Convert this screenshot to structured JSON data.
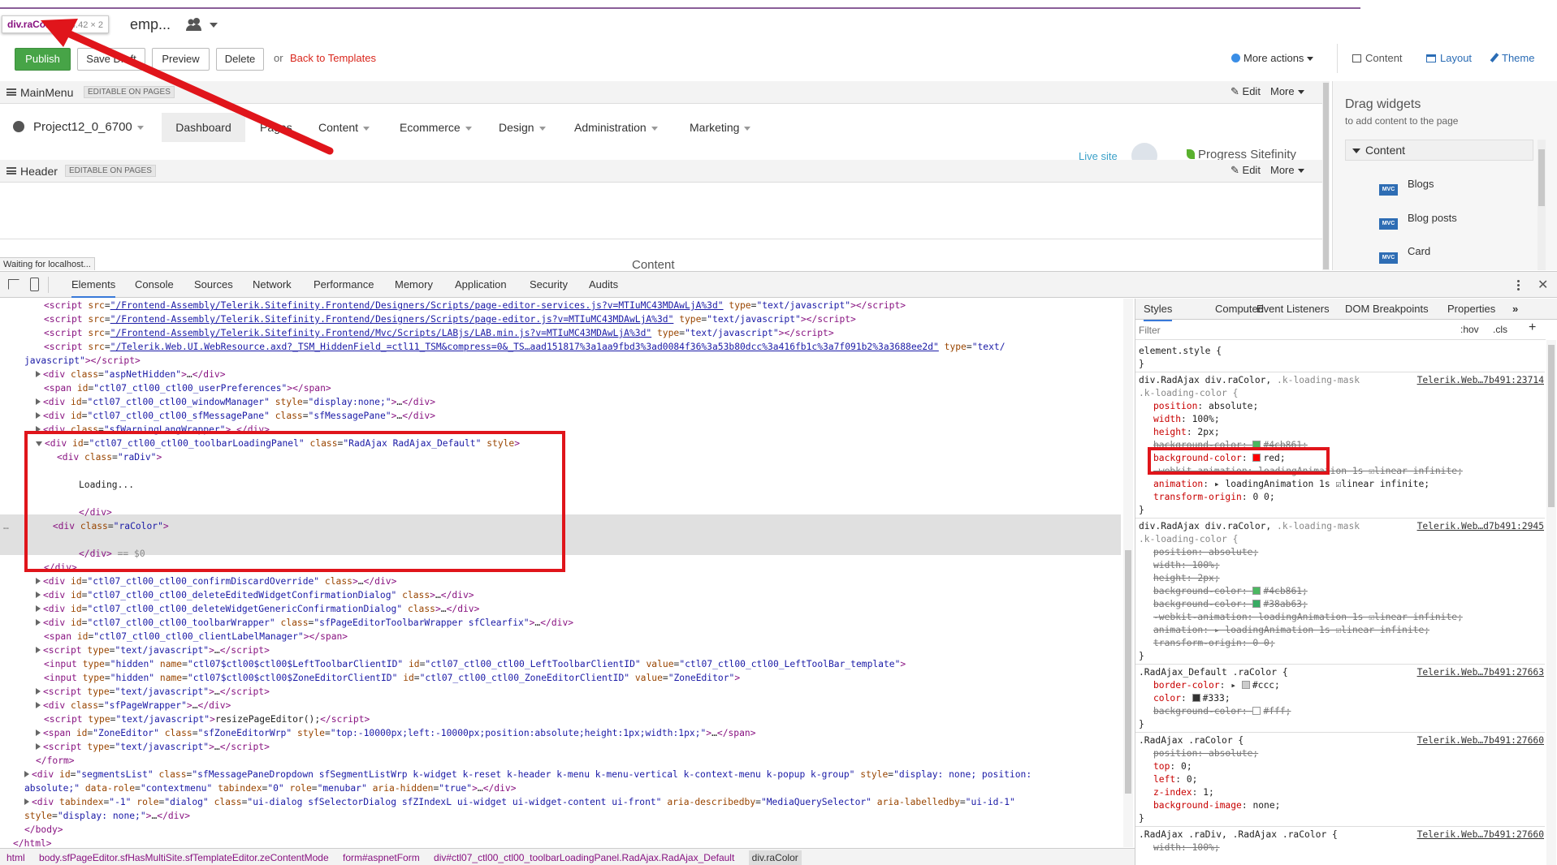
{
  "tooltip": {
    "element": "div.raColor",
    "size": "74.42 × 2"
  },
  "page_title_fragment": "emp...",
  "toolbar": {
    "publish": "Publish",
    "save_draft": "Save Draft",
    "preview": "Preview",
    "delete": "Delete",
    "or_text": "or",
    "back_link": "Back to Templates",
    "more_actions": "More actions",
    "modes": [
      "Content",
      "Layout",
      "Theme"
    ]
  },
  "zones": {
    "mainmenu": {
      "label": "MainMenu",
      "tag": "EDITABLE ON PAGES",
      "edit": "Edit",
      "more": "More"
    },
    "header": {
      "label": "Header",
      "tag": "EDITABLE ON PAGES",
      "edit": "Edit",
      "more": "More"
    }
  },
  "site_nav": {
    "project": "Project12_0_6700",
    "items": [
      "Dashboard",
      "Pages",
      "Content",
      "Ecommerce",
      "Design",
      "Administration",
      "Marketing"
    ],
    "live_site": "Live site",
    "brand": "Progress Sitefinity"
  },
  "status_text": "Waiting for localhost...",
  "content_placeholder": "Content",
  "widgets_panel": {
    "title": "Drag widgets",
    "subtitle": "to add content to the page",
    "group": "Content",
    "badge": "MVC",
    "items": [
      "Blogs",
      "Blog posts",
      "Card"
    ]
  },
  "devtools": {
    "tabs": [
      "Elements",
      "Console",
      "Sources",
      "Network",
      "Performance",
      "Memory",
      "Application",
      "Security",
      "Audits"
    ],
    "style_tabs": [
      "Styles",
      "Computed",
      "Event Listeners",
      "DOM Breakpoints",
      "Properties"
    ],
    "filter_placeholder": "Filter",
    "hov": ":hov",
    "cls": ".cls",
    "breadcrumbs": [
      "html",
      "body.sfPageEditor.sfHasMultiSite.sfTemplateEditor.zeContentMode",
      "form#aspnetForm",
      "div#ctl07_ctl00_ctl00_toolbarLoadingPanel.RadAjax.RadAjax_Default",
      "div.raColor"
    ],
    "sources": [
      "Telerik.Web…7b491:23714",
      "Telerik.Web…d7b491:2945",
      "Telerik.Web…7b491:27663",
      "Telerik.Web…7b491:27660",
      "Telerik.Web…7b491:27660"
    ]
  },
  "accent_colors": {
    "publish": "#47a447",
    "link": "#d9261c",
    "highlight_box": "#e0151b",
    "purple_bar": "#8a5e98"
  }
}
